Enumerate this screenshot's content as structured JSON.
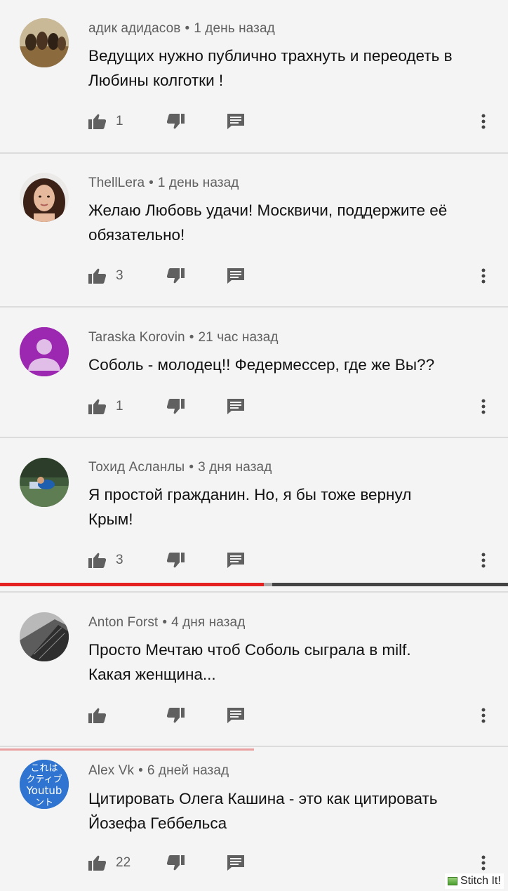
{
  "comments": [
    {
      "author": "адик адидасов",
      "time": "1 день назад",
      "text_lines": [
        "Ведущих нужно публично трахнуть и переодеть в",
        "Любины колготки !"
      ],
      "likes": "1",
      "avatar": "photo-horses"
    },
    {
      "author": "ThellLera",
      "time": "1 день назад",
      "text_lines": [
        "Желаю Любовь удачи! Москвичи, поддержите её",
        "обязательно!"
      ],
      "likes": "3",
      "avatar": "photo-woman"
    },
    {
      "author": "Taraska Korovin",
      "time": "21 час назад",
      "text_lines": [
        "Соболь - молодец!! Федермессер, где же Вы??"
      ],
      "likes": "1",
      "avatar": "default-person-icon"
    },
    {
      "author": "Тохид Асланлы",
      "time": "3 дня назад",
      "text_lines": [
        "Я простой гражданин. Но, я бы тоже вернул",
        "Крым!"
      ],
      "likes": "3",
      "avatar": "photo-athlete"
    },
    {
      "author": "Anton Forst",
      "time": "4 дня назад",
      "text_lines": [
        "Просто Мечтаю чтоб Соболь сыграла в milf.",
        "Какая женщина..."
      ],
      "likes": "",
      "avatar": "photo-building"
    },
    {
      "author": "Alex Vk",
      "time": "6 дней назад",
      "text_lines": [
        "Цитировать Олега Кашина - это как цитировать",
        "Йозефа Геббельса"
      ],
      "likes": "22",
      "avatar": "blue-text-logo"
    }
  ],
  "avatar6_lines": [
    "これは",
    "クティブ",
    "Youtub",
    "ント"
  ],
  "video_progress": {
    "played": 0.52
  },
  "watermark": "Stitch It!",
  "colors": {
    "background": "#f4f4f4",
    "meta": "#606060",
    "icon": "#606060",
    "progress": "#e52020",
    "avatar_purple": "#9c27b0",
    "avatar_blue": "#2f74d0"
  },
  "icons": {
    "like": "thumb-up-icon",
    "dislike": "thumb-down-icon",
    "reply": "reply-comment-icon",
    "more": "more-vertical-icon"
  }
}
